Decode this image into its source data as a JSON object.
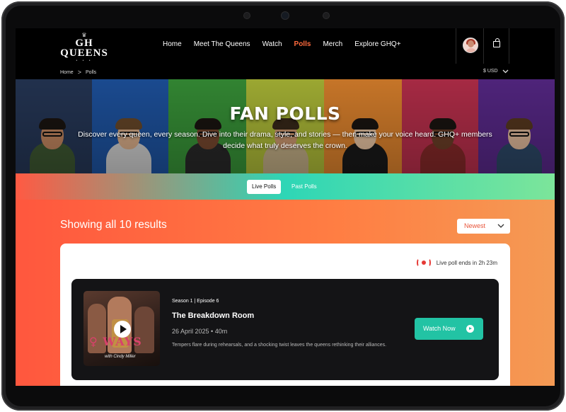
{
  "brand": {
    "name_line1": "GH",
    "name_line2": "QUEENS"
  },
  "nav": {
    "items": [
      "Home",
      "Meet The Queens",
      "Watch",
      "Polls",
      "Merch",
      "Explore GHQ+"
    ],
    "active": "Polls"
  },
  "icons": {
    "cart": "shopping-bag-icon",
    "avatar": "user-avatar",
    "live": "live-broadcast-icon",
    "play": "play-icon"
  },
  "breadcrumb": {
    "home": "Home",
    "separator": ">",
    "current": "Polls"
  },
  "currency": {
    "label": "$ USD"
  },
  "hero": {
    "title": "FAN POLLS",
    "description": "Discover every queen, every season. Dive into their drama, style, and stories — then make your voice heard. GHQ+ members decide what truly deserves the crown."
  },
  "tabs": {
    "live": "Live Polls",
    "past": "Past Polls",
    "active": "Live Polls"
  },
  "results": {
    "summary": "Showing all 10 results",
    "sort_selected": "Newest"
  },
  "live_status": {
    "text": "Live poll ends in 2h 23m"
  },
  "episode": {
    "meta": "Season 1  |  Episode 6",
    "title": "The Breakdown Room",
    "date": "26 April 2025 • 40m",
    "description": "Tempers flare during rehearsals, and a shocking twist leaves the queens rethinking their alliances.",
    "cta": "Watch Now"
  },
  "colors": {
    "accent_active_nav": "#ff6a3d",
    "cta": "#22c3a4",
    "live_red": "#e53935",
    "gradient_start": "#ff573e",
    "gradient_end": "#f49a54"
  }
}
